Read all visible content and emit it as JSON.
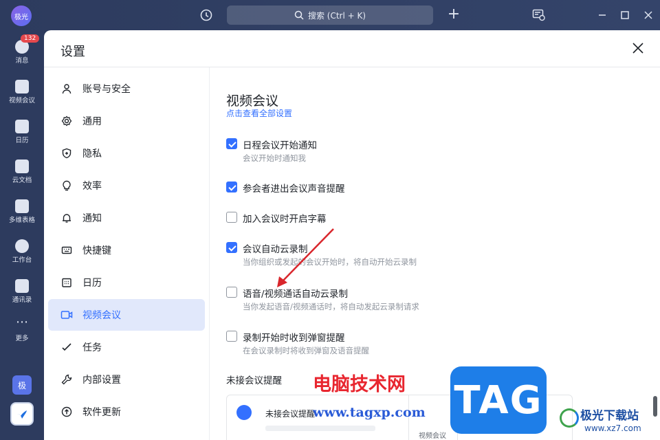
{
  "topbar": {
    "avatar_text": "极光",
    "search_placeholder": "搜索 (Ctrl + K)"
  },
  "rail": {
    "items": [
      {
        "label": "消息",
        "badge": "132"
      },
      {
        "label": "视频会议"
      },
      {
        "label": "日历"
      },
      {
        "label": "云文档"
      },
      {
        "label": "多维表格"
      },
      {
        "label": "工作台"
      },
      {
        "label": "通讯录"
      },
      {
        "label": "更多"
      }
    ],
    "ji_label": "极"
  },
  "settings": {
    "title": "设置",
    "nav": [
      {
        "label": "账号与安全",
        "icon": "user-icon"
      },
      {
        "label": "通用",
        "icon": "gear-icon"
      },
      {
        "label": "隐私",
        "icon": "shield-icon"
      },
      {
        "label": "效率",
        "icon": "bulb-icon"
      },
      {
        "label": "通知",
        "icon": "bell-icon"
      },
      {
        "label": "快捷键",
        "icon": "keyboard-icon"
      },
      {
        "label": "日历",
        "icon": "calendar-icon"
      },
      {
        "label": "视频会议",
        "icon": "video-icon",
        "active": true
      },
      {
        "label": "任务",
        "icon": "task-icon"
      },
      {
        "label": "内部设置",
        "icon": "wrench-icon"
      },
      {
        "label": "软件更新",
        "icon": "update-icon"
      }
    ],
    "section": {
      "title": "视频会议",
      "link": "点击查看全部设置",
      "options": [
        {
          "label": "日程会议开始通知",
          "desc": "会议开始时通知我",
          "checked": true
        },
        {
          "label": "参会者进出会议声音提醒",
          "desc": "",
          "checked": true
        },
        {
          "label": "加入会议时开启字幕",
          "desc": "",
          "checked": false
        },
        {
          "label": "会议自动云录制",
          "desc": "当你组织或发起的会议开始时，将自动开始云录制",
          "checked": true
        },
        {
          "label": "语音/视频通话自动云录制",
          "desc": "当你发起语音/视频通话时，将自动发起云录制请求",
          "checked": false
        },
        {
          "label": "录制开始时收到弹窗提醒",
          "desc": "在会议录制时将收到弹窗及语音提醒",
          "checked": false
        }
      ],
      "missed_title": "未接会议提醒",
      "preview_text": "未接会议提醒",
      "preview_box_label": "视频会议"
    }
  },
  "watermark": {
    "cn": "电脑技术网",
    "url": "www.tagxp.com",
    "tag": "TAG",
    "site_name": "极光下载站",
    "site_url": "www.xz7.com"
  },
  "colors": {
    "accent": "#3370ff",
    "sidebar_bg": "#2d3b5e",
    "active_nav_bg": "#e1e8fb",
    "annotation_arrow": "#d9262c"
  }
}
